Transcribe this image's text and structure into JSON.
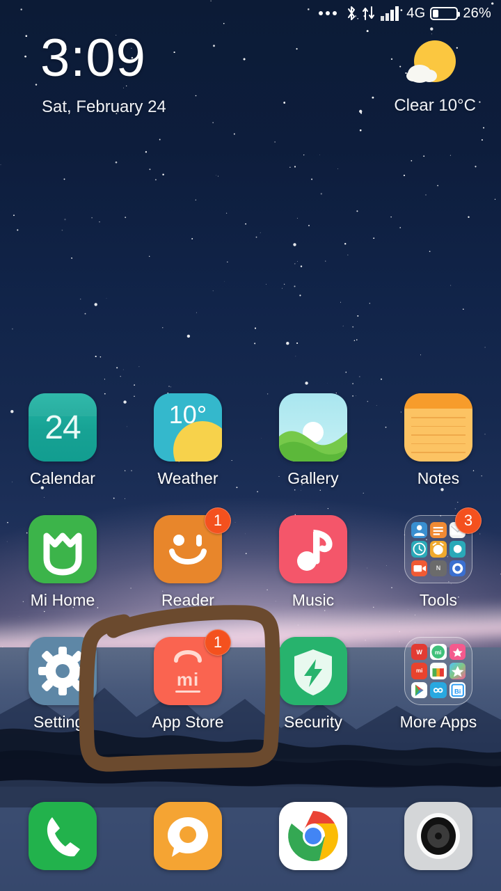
{
  "status_bar": {
    "notification_dots": "more-notifications",
    "bluetooth": "bluetooth-icon",
    "data_transfer": "data-transfer-icon",
    "signal": "signal-bars-icon",
    "network_type": "4G",
    "battery_icon": "battery-icon",
    "battery_percent": "26%",
    "battery_level": 26
  },
  "widget": {
    "time": "3:09",
    "date": "Sat, February 24",
    "weather_icon": "sun-behind-cloud-icon",
    "weather_text": "Clear  10°C",
    "condition": "Clear",
    "temperature": "10°C"
  },
  "home_screen": {
    "rows": [
      [
        {
          "label": "Calendar",
          "icon": "calendar-icon",
          "icon_text": "24",
          "bg": "#1aa89a",
          "badge": null
        },
        {
          "label": "Weather",
          "icon": "weather-icon",
          "icon_text": "10°",
          "bg": "#34b8cc",
          "badge": null
        },
        {
          "label": "Gallery",
          "icon": "gallery-icon",
          "icon_text": "",
          "bg": "#9ce0ea",
          "badge": null
        },
        {
          "label": "Notes",
          "icon": "notes-icon",
          "icon_text": "",
          "bg": "#fdc162",
          "badge": null
        }
      ],
      [
        {
          "label": "Mi Home",
          "icon": "mi-home-icon",
          "icon_text": "",
          "bg": "#3db54a",
          "badge": null
        },
        {
          "label": "Reader",
          "icon": "reader-icon",
          "icon_text": "",
          "bg": "#e8862b",
          "badge": "1"
        },
        {
          "label": "Music",
          "icon": "music-icon",
          "icon_text": "",
          "bg": "#f4566a",
          "badge": null
        },
        {
          "label": "Tools",
          "icon": "tools-folder",
          "icon_text": "",
          "bg": "folder",
          "badge": "3"
        }
      ],
      [
        {
          "label": "Settings",
          "icon": "settings-icon",
          "icon_text": "",
          "bg": "#5e87a6",
          "badge": null
        },
        {
          "label": "App Store",
          "icon": "app-store-icon",
          "icon_text": "mi",
          "bg": "#fa6450",
          "badge": "1"
        },
        {
          "label": "Security",
          "icon": "security-icon",
          "icon_text": "",
          "bg": "#27b36d",
          "badge": null
        },
        {
          "label": "More Apps",
          "icon": "more-apps-folder",
          "icon_text": "",
          "bg": "folder",
          "badge": null
        }
      ]
    ],
    "tools_folder_apps": [
      "contacts-icon",
      "notes-icon",
      "mail-icon",
      "clock-icon",
      "alarm-icon",
      "compass-icon",
      "video-recorder-icon",
      "notes-n-icon",
      "browser-icon"
    ],
    "more_apps_folder_apps": [
      "wps-office-icon",
      "mi-chat-icon",
      "pink-app-icon",
      "mi-icon",
      "mi-store-icon",
      "star-gallery-icon",
      "play-store-icon",
      "infinity-icon",
      "bi-app-icon"
    ]
  },
  "dock": [
    {
      "label": "Phone",
      "icon": "phone-icon",
      "bg": "#22b24c"
    },
    {
      "label": "Messaging",
      "icon": "messaging-icon",
      "bg": "#f5a433"
    },
    {
      "label": "Chrome",
      "icon": "chrome-icon",
      "bg": "#ffffff"
    },
    {
      "label": "Camera",
      "icon": "camera-icon",
      "bg": "#d4d6d8"
    }
  ],
  "annotation": {
    "shape": "hand-drawn-rectangle-highlight",
    "color": "#6b4a2e",
    "target": "App Store"
  }
}
